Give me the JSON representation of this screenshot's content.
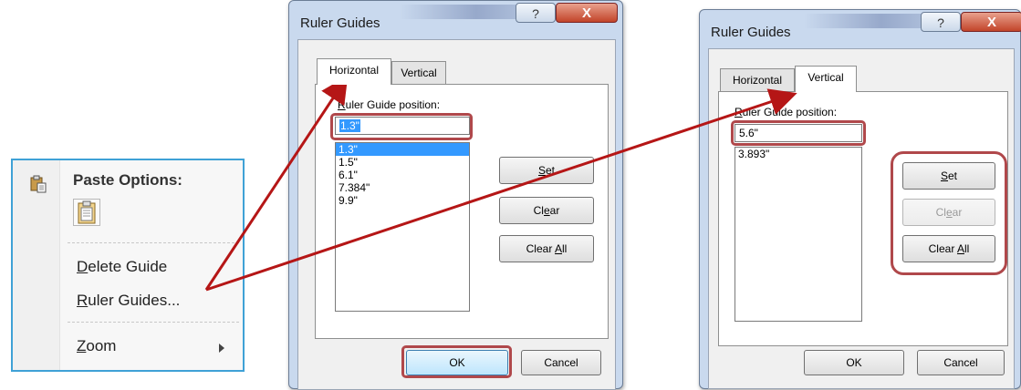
{
  "context_menu": {
    "paste_options_label": "Paste Options:",
    "items": [
      {
        "label": "Delete Guide",
        "accesskey_prefix": "",
        "accesskey": "D",
        "rest": "elete Guide"
      },
      {
        "label": "Ruler Guides...",
        "accesskey_prefix": "",
        "accesskey": "R",
        "rest": "uler Guides..."
      },
      {
        "label": "Zoom",
        "accesskey_prefix": "",
        "accesskey": "Z",
        "rest": "oom"
      }
    ]
  },
  "dialog_horizontal": {
    "title": "Ruler Guides",
    "help_label": "?",
    "close_label": "X",
    "tabs": [
      {
        "label": "Horizontal"
      },
      {
        "label": "Vertical"
      }
    ],
    "position_label_key": "R",
    "position_label_rest": "uler Guide position:",
    "position_value": "1.3\"",
    "list": [
      "1.3\"",
      "1.5\"",
      "6.1\"",
      "7.384\"",
      "9.9\""
    ],
    "set": {
      "pre": "",
      "key": "S",
      "post": "et"
    },
    "clear": {
      "pre": "Cl",
      "key": "e",
      "post": "ar"
    },
    "clear_all": {
      "pre": "Clear ",
      "key": "A",
      "post": "ll"
    },
    "ok_label": "OK",
    "cancel_label": "Cancel"
  },
  "dialog_vertical": {
    "title": "Ruler Guides",
    "help_label": "?",
    "close_label": "X",
    "tabs": [
      {
        "label": "Horizontal"
      },
      {
        "label": "Vertical"
      }
    ],
    "position_label_key": "R",
    "position_label_rest": "uler Guide position:",
    "position_value": "5.6\"",
    "list": [
      "3.893\""
    ],
    "set": {
      "pre": "",
      "key": "S",
      "post": "et"
    },
    "clear": {
      "pre": "Cl",
      "key": "e",
      "post": "ar"
    },
    "clear_all": {
      "pre": "Clear ",
      "key": "A",
      "post": "ll"
    },
    "ok_label": "OK",
    "cancel_label": "Cancel"
  },
  "annotation_color": "#b0484b",
  "arrow_color": "#b51616"
}
